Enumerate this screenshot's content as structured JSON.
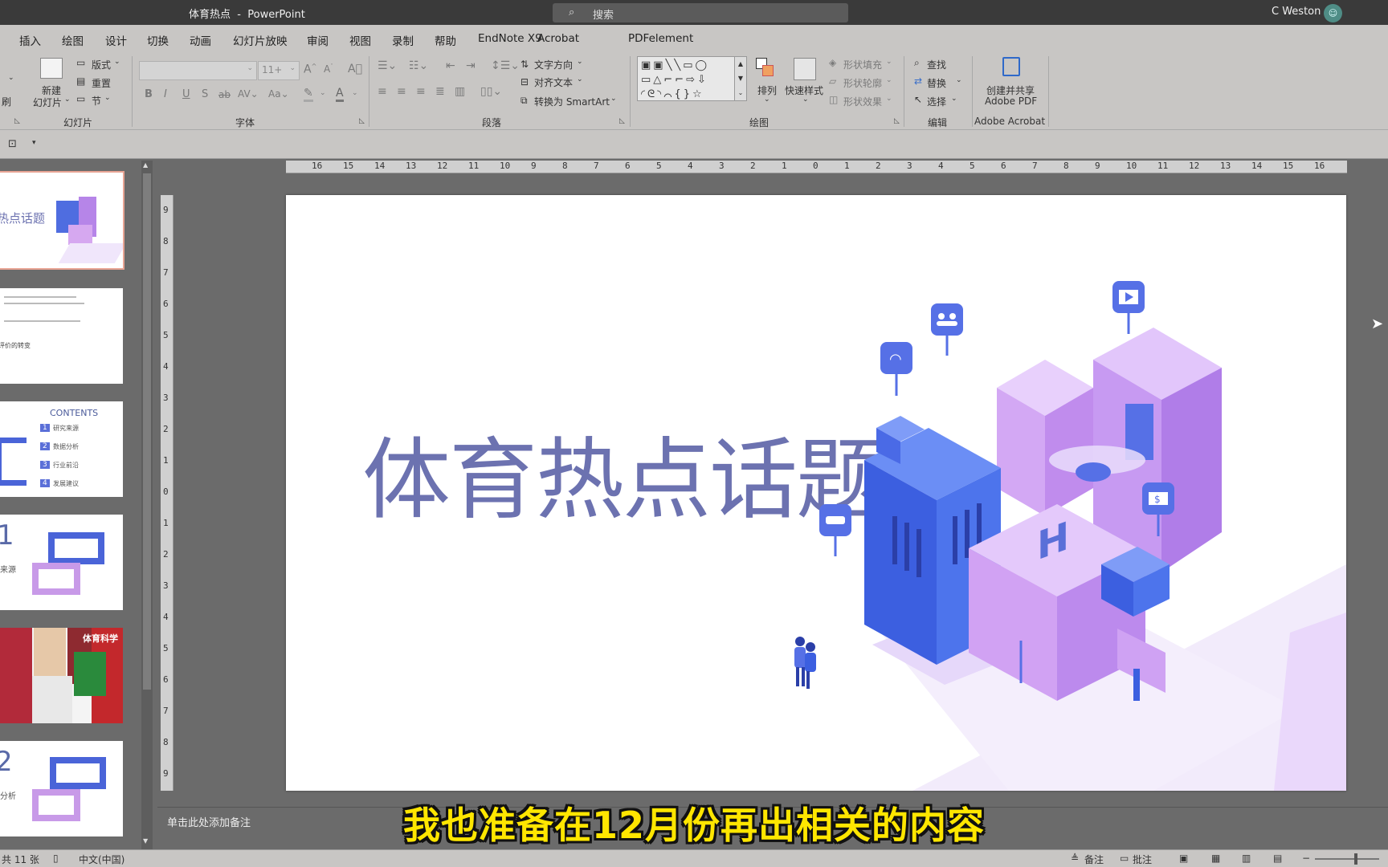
{
  "window": {
    "doc_name": "体育热点",
    "separator": "-",
    "app_name": "PowerPoint",
    "search_placeholder": "搜索",
    "user_name": "C Weston"
  },
  "menu": [
    "插入",
    "绘图",
    "设计",
    "切换",
    "动画",
    "幻灯片放映",
    "审阅",
    "视图",
    "录制",
    "帮助",
    "EndNote X9",
    "Acrobat",
    "PDFelement"
  ],
  "ribbon": {
    "slides": {
      "new_slide_1": "新建",
      "new_slide_2": "幻灯片",
      "layout": "版式",
      "reset": "重置",
      "section": "节",
      "group": "幻灯片",
      "cut_label": "刷"
    },
    "font": {
      "size": "11+",
      "group": "字体"
    },
    "paragraph": {
      "text_direction": "文字方向",
      "align_text": "对齐文本",
      "smartart": "转换为 SmartArt",
      "group": "段落"
    },
    "drawing": {
      "arrange": "排列",
      "quick_styles": "快速样式",
      "shape_fill": "形状填充",
      "shape_outline": "形状轮廓",
      "shape_effects": "形状效果",
      "group": "绘图"
    },
    "editing": {
      "find": "查找",
      "replace": "替换",
      "select": "选择",
      "group": "编辑"
    },
    "acrobat": {
      "create_1": "创建并共享",
      "create_2": "Adobe PDF",
      "group": "Adobe Acrobat"
    }
  },
  "thumbnails": {
    "t1_title": "热点话题",
    "t2_heading": "评价的转变",
    "t3_title": "CONTENTS",
    "t3_items": [
      "研究来源",
      "数据分析",
      "行业前沿",
      "发展建议"
    ],
    "t3_nums": [
      "1",
      "2",
      "3",
      "4"
    ],
    "t4_num": "1",
    "t4_label": "来源",
    "t5_badge": "体育科学",
    "t6_num": "2",
    "t6_label": "分析"
  },
  "ruler": {
    "h": [
      "16",
      "15",
      "14",
      "13",
      "12",
      "11",
      "10",
      "9",
      "8",
      "7",
      "6",
      "5",
      "4",
      "3",
      "2",
      "1",
      "0",
      "1",
      "2",
      "3",
      "4",
      "5",
      "6",
      "7",
      "8",
      "9",
      "10",
      "11",
      "12",
      "13",
      "14",
      "15",
      "16"
    ],
    "v": [
      "9",
      "8",
      "7",
      "6",
      "5",
      "4",
      "3",
      "2",
      "1",
      "0",
      "1",
      "2",
      "3",
      "4",
      "5",
      "6",
      "7",
      "8",
      "9"
    ]
  },
  "slide": {
    "title": "体育热点话题",
    "heli_label": "H",
    "sign_dollar": "$"
  },
  "notes_placeholder": "单击此处添加备注",
  "subtitle": "我也准备在12月份再出相关的内容",
  "status": {
    "slide_count": "共 11 张",
    "language": "中文(中国)",
    "notes": "备注",
    "comments": "批注"
  },
  "colors": {
    "title": "#6c72b0",
    "accent_selected": "#e8a494",
    "subtitle": "#ffe600"
  }
}
